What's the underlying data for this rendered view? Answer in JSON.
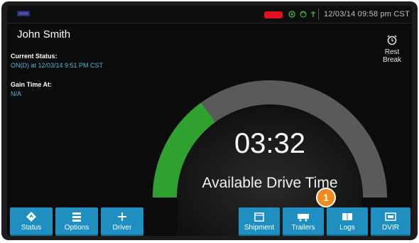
{
  "statusbar": {
    "time": "12/03/14 09:58 pm CST",
    "battery_color": "#e0101e"
  },
  "driver": {
    "name": "John Smith"
  },
  "current_status": {
    "label": "Current Status:",
    "value": "ON(D) at 12/03/14 9:51 PM CST"
  },
  "gain_time": {
    "label": "Gain Time At:",
    "value": "N/A"
  },
  "rest_break": {
    "line1": "Rest",
    "line2": "Break",
    "icon": "alarm-clock-icon"
  },
  "drive": {
    "time": "03:32",
    "label": "Available Drive Time",
    "remaining_fraction": 0.3
  },
  "buttons": {
    "status": {
      "label": "Status",
      "icon": "diamond-arrow-icon"
    },
    "options": {
      "label": "Options",
      "icon": "list-icon"
    },
    "driver": {
      "label": "Driver",
      "icon": "plus-icon"
    },
    "shipment": {
      "label": "Shipment",
      "icon": "box-icon"
    },
    "trailers": {
      "label": "Trailers",
      "icon": "trailer-icon"
    },
    "logs": {
      "label": "Logs",
      "icon": "book-icon"
    },
    "dvir": {
      "label": "DVIR",
      "icon": "card-icon"
    }
  },
  "callout": {
    "number": "1"
  },
  "colors": {
    "accent": "#1e8fc0",
    "gauge_green": "#2fa12f",
    "badge": "#f08a1a"
  }
}
